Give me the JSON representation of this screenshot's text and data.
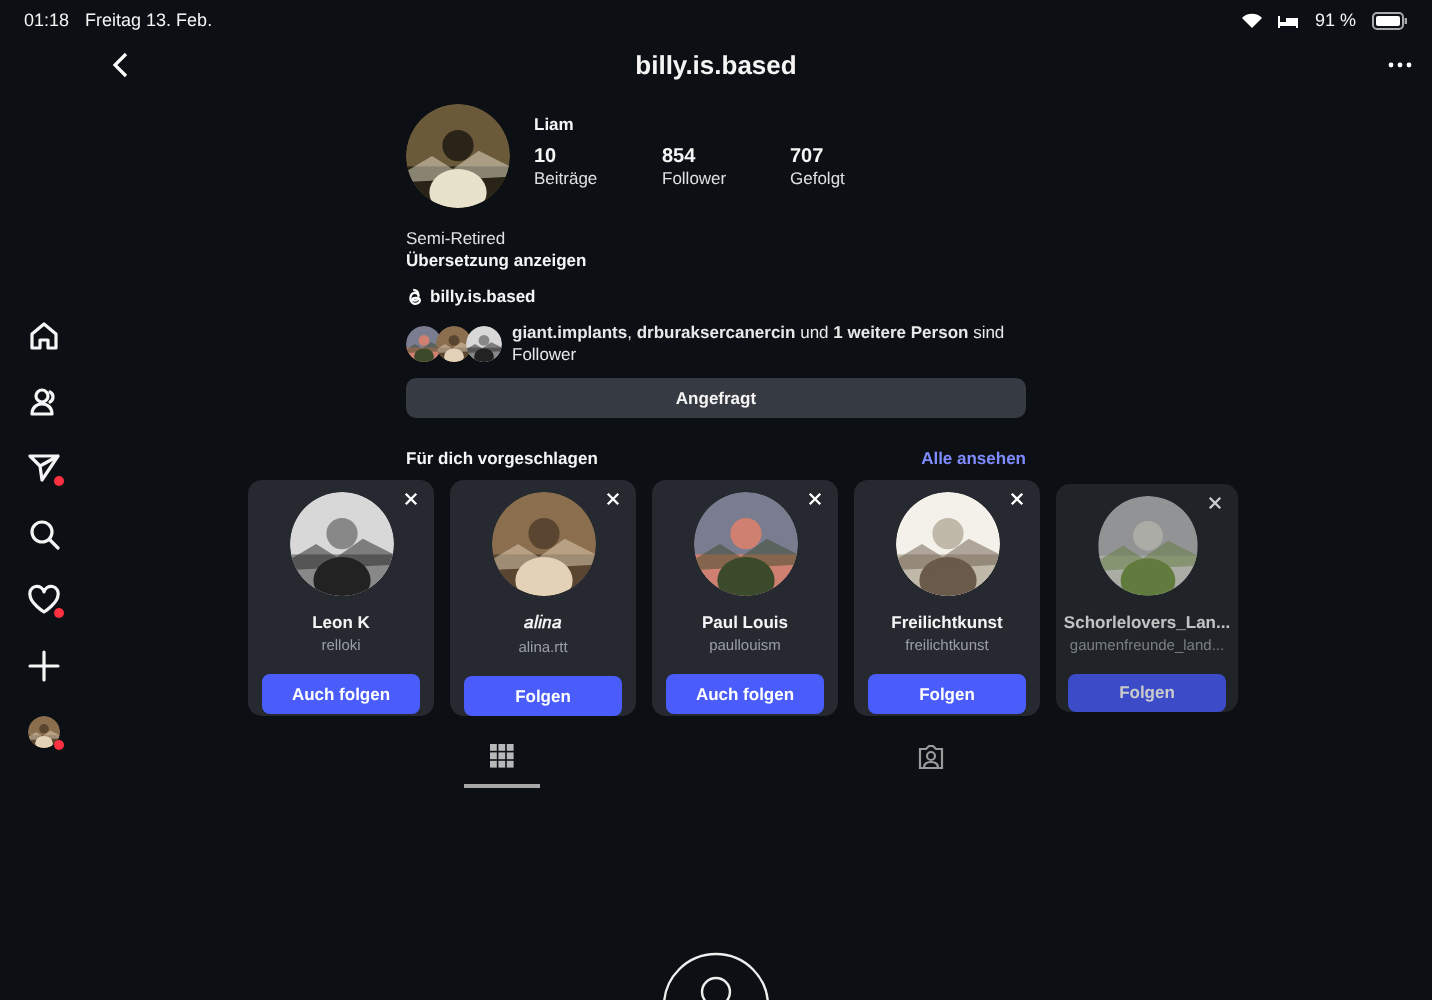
{
  "status_bar": {
    "time": "01:18",
    "date": "Freitag 13. Feb.",
    "battery": "91 %"
  },
  "header": {
    "title": "billy.is.based"
  },
  "sidebar": {
    "items": [
      {
        "kind": "home",
        "badge": false
      },
      {
        "kind": "people",
        "badge": false
      },
      {
        "kind": "send",
        "badge": true
      },
      {
        "kind": "search",
        "badge": false
      },
      {
        "kind": "heart",
        "badge": true
      },
      {
        "kind": "plus",
        "badge": false
      },
      {
        "kind": "avatar",
        "badge": true
      }
    ]
  },
  "profile": {
    "name": "Liam",
    "stats": [
      {
        "value": "10",
        "label": "Beiträge"
      },
      {
        "value": "854",
        "label": "Follower"
      },
      {
        "value": "707",
        "label": "Gefolgt"
      }
    ],
    "bio": "Semi-Retired",
    "translate": "Übersetzung anzeigen",
    "threads": "billy.is.based",
    "followed_by": "**giant.implants**, **drburaksercanercin** und **1 weitere Person** sind Follower",
    "request_button": "Angefragt"
  },
  "suggestions": {
    "title": "Für dich vorgeschlagen",
    "see_all": "Alle ansehen",
    "cards": [
      {
        "name": "Leon K",
        "username": "relloki",
        "button": "Auch folgen",
        "dimmed": false
      },
      {
        "name": "𝑎𝑙𝑖𝑛𝑎",
        "username": "alina.rtt",
        "button": "Folgen",
        "dimmed": false
      },
      {
        "name": "Paul Louis",
        "username": "paullouism",
        "button": "Auch folgen",
        "dimmed": false
      },
      {
        "name": "Freilichtkunst",
        "username": "freilichtkunst",
        "button": "Folgen",
        "dimmed": false
      },
      {
        "name": "Schorlelovers_Lan...",
        "username": "gaumenfreunde_land...",
        "button": "Folgen",
        "dimmed": true
      }
    ]
  },
  "tabs": [
    {
      "kind": "grid",
      "selected": true
    },
    {
      "kind": "tagged",
      "selected": false
    }
  ]
}
